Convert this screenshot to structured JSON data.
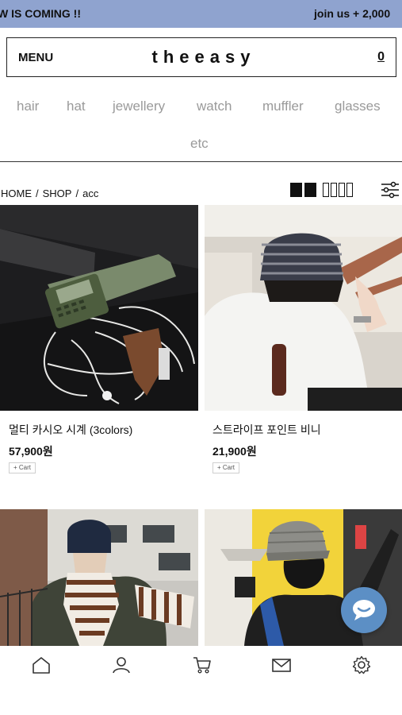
{
  "marquee": {
    "left_text": "W IS COMING !!",
    "right_text": "join us + 2,000"
  },
  "header": {
    "menu_label": "MENU",
    "logo": "theeasy",
    "cart_count": "0"
  },
  "categories": [
    "hair",
    "hat",
    "jewellery",
    "watch",
    "muffler",
    "glasses",
    "etc"
  ],
  "breadcrumb": [
    "HOME",
    "SHOP",
    "acc"
  ],
  "breadcrumb_sep": "/",
  "products": [
    {
      "name": "멀티 카시오 시계 (3colors)",
      "price": "57,900원",
      "cart_label": "+ Cart"
    },
    {
      "name": "스트라이프 포인트 비니",
      "price": "21,900원",
      "cart_label": "+ Cart"
    }
  ],
  "icons": {
    "home": "home-icon",
    "account": "user-icon",
    "cart": "cart-icon",
    "mail": "mail-icon",
    "settings": "gear-icon",
    "chat": "chat-icon",
    "filter": "filter-icon"
  },
  "colors": {
    "marquee_bg": "#8fa3cf",
    "category_text": "#9a9a9a",
    "chat_button": "#5c8fc5"
  }
}
